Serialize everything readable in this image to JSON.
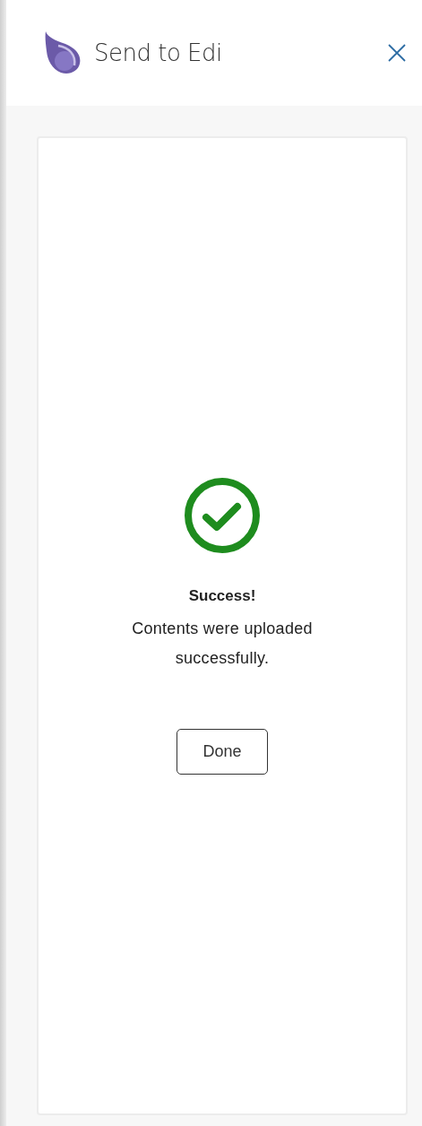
{
  "header": {
    "title": "Send to Edi"
  },
  "result": {
    "succeeded": true,
    "heading": "Success!",
    "message": "Contents were uploaded successfully.",
    "button": "Done"
  }
}
